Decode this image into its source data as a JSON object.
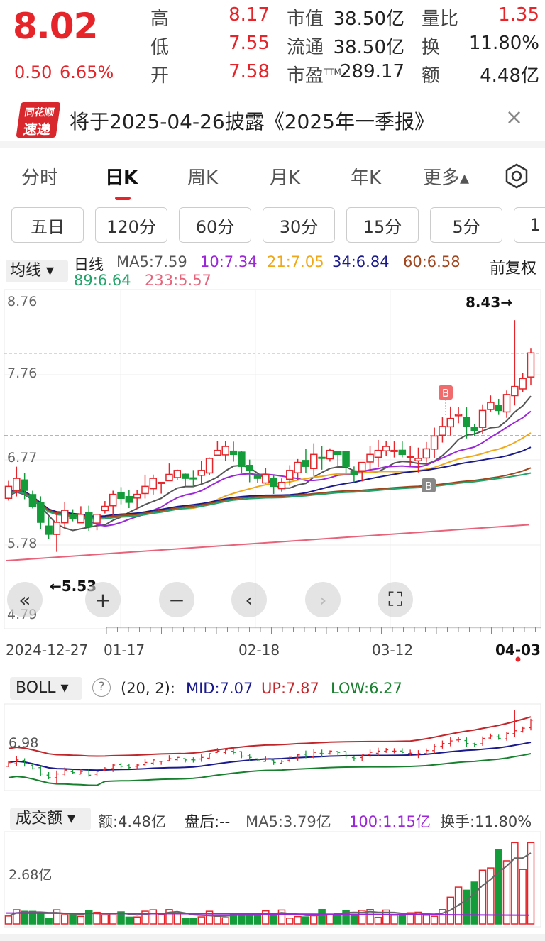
{
  "quote": {
    "price": "8.02",
    "change": "0.50",
    "change_pct": "6.65%",
    "stats": [
      {
        "label": "高",
        "value": "8.17",
        "color": "#e5252a"
      },
      {
        "label": "低",
        "value": "7.55",
        "color": "#e5252a"
      },
      {
        "label": "开",
        "value": "7.58",
        "color": "#e5252a"
      },
      {
        "label": "市值",
        "value": "38.50亿",
        "color": "#222"
      },
      {
        "label": "流通",
        "value": "38.50亿",
        "color": "#222"
      },
      {
        "label": "市盈",
        "sup": "TTM",
        "value": "289.17",
        "color": "#222"
      },
      {
        "label": "量比",
        "value": "1.35",
        "color": "#e5252a"
      },
      {
        "label": "换",
        "value": "11.80%",
        "color": "#222"
      },
      {
        "label": "额",
        "value": "4.48亿",
        "color": "#222"
      }
    ]
  },
  "news": {
    "logo_top": "同花顺",
    "logo_bottom": "速递",
    "text": "将于2025-04-26披露《2025年一季报》",
    "close": "×"
  },
  "tabs": [
    "分时",
    "日K",
    "周K",
    "月K",
    "年K",
    "更多▴"
  ],
  "active_tab": "日K",
  "periods": [
    "五日",
    "120分",
    "60分",
    "30分",
    "15分",
    "5分",
    "1"
  ],
  "ma_bar": {
    "selector": "均线 ▾",
    "label": "日线",
    "ma5": "MA5:7.59",
    "ma10": "10:7.34",
    "ma21": "21:7.05",
    "ma34": "34:6.84",
    "ma60": "60:6.58",
    "ma89": "89:6.64",
    "ma233": "233:5.57",
    "adjust": "前复权"
  },
  "main_chart": {
    "y_ticks": [
      "8.76",
      "7.76",
      "6.77",
      "5.78",
      "4.79"
    ],
    "max_label": "8.43→",
    "min_label": "←5.53",
    "x_dates": [
      "2024-12-27",
      "01-17",
      "02-18",
      "03-12",
      "04-03"
    ],
    "marker": "B"
  },
  "nav_buttons": [
    "«",
    "+",
    "−",
    "‹",
    "›",
    "⛶"
  ],
  "boll": {
    "selector": "BOLL ▾",
    "help": "?",
    "params": "(20, 2):",
    "mid": "MID:7.07",
    "up": "UP:7.87",
    "low": "LOW:6.27",
    "y_tick": "6.98"
  },
  "volume": {
    "selector": "成交额 ▾",
    "amount": "额:4.48亿",
    "after": "盘后:--",
    "ma5": "MA5:3.79亿",
    "ma100": "100:1.15亿",
    "turnover": "换手:11.80%",
    "y_tick": "2.68亿"
  },
  "colors": {
    "up": "#e5252a",
    "down": "#159c3a",
    "ma5": "#555555",
    "ma10": "#9b27d9",
    "ma21": "#f0a818",
    "ma34": "#1a1a8c",
    "ma60": "#a0461e",
    "ma89": "#23a36a",
    "ma233": "#e8627a"
  },
  "chart_data": {
    "type": "candlestick",
    "dates_shown": [
      "2024-12-27",
      "01-17",
      "02-18",
      "03-12",
      "04-03"
    ],
    "high": 8.43,
    "low": 5.53,
    "last_close": 8.02,
    "ylim": [
      4.79,
      8.76
    ]
  }
}
